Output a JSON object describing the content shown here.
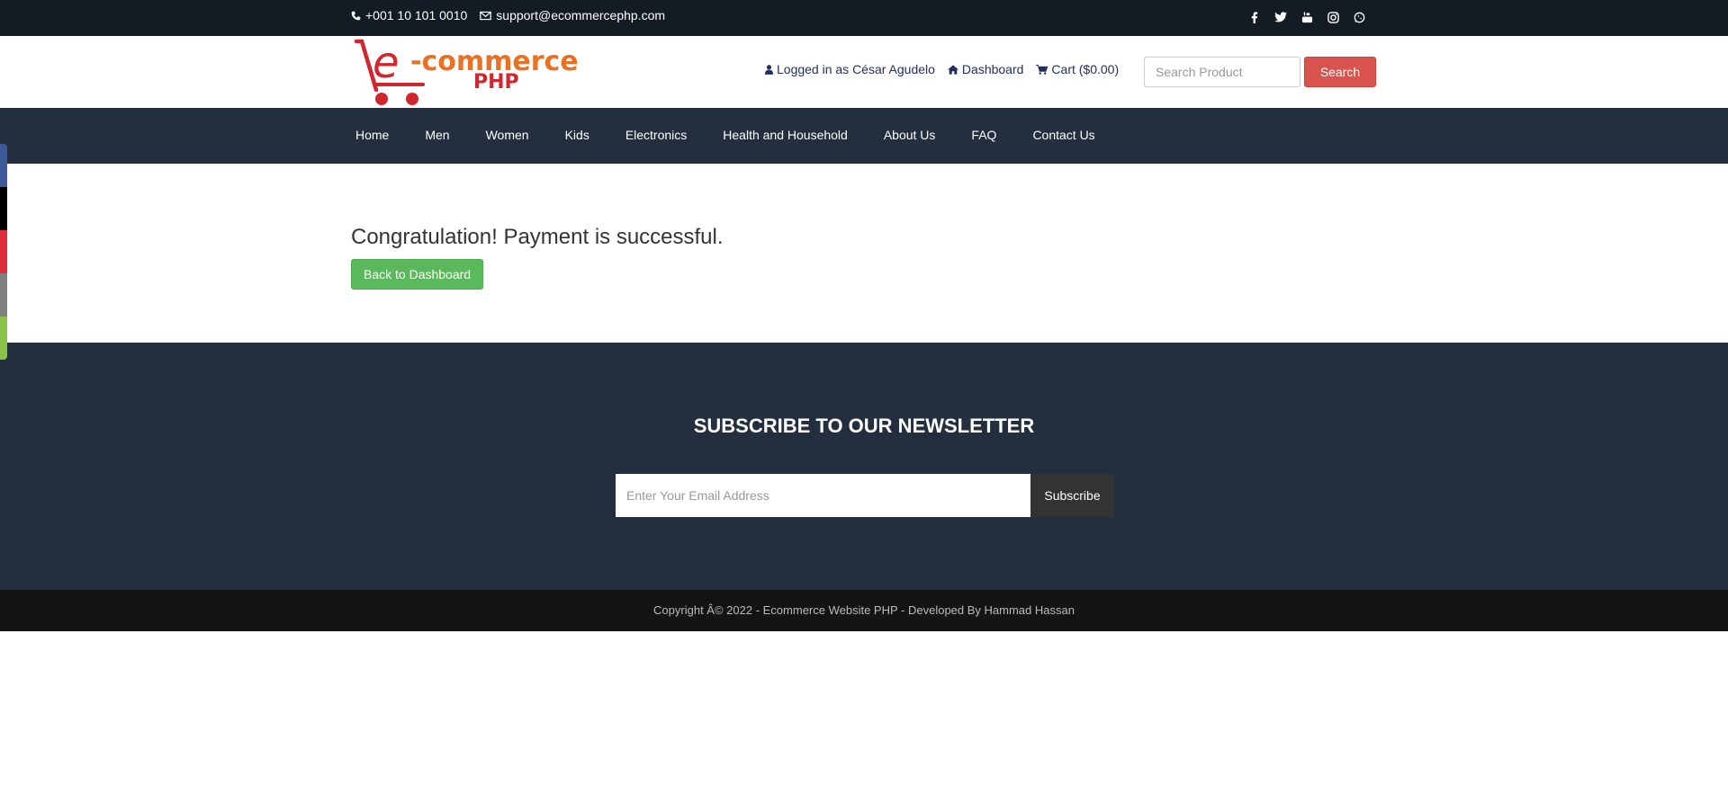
{
  "topbar": {
    "phone": "+001 10 101 0010",
    "email": "support@ecommercephp.com",
    "social_icons": [
      "facebook-icon",
      "twitter-icon",
      "youtube-icon",
      "instagram-icon",
      "whatsapp-icon"
    ]
  },
  "header": {
    "logo_text_main": "-commerce",
    "logo_text_sub": "PHP",
    "logged_in": "Logged in as César Agudelo",
    "dashboard": "Dashboard",
    "cart": "Cart ($0.00)",
    "search_placeholder": "Search Product",
    "search_button": "Search"
  },
  "nav": {
    "items": [
      "Home",
      "Men",
      "Women",
      "Kids",
      "Electronics",
      "Health and Household",
      "About Us",
      "FAQ",
      "Contact Us"
    ]
  },
  "side_strip_colors": [
    "#3b5998",
    "#000000",
    "#dd2e3a",
    "#7f7f7f",
    "#8bc34a"
  ],
  "main": {
    "message": "Congratulation! Payment is successful.",
    "back_button": "Back to Dashboard"
  },
  "newsletter": {
    "title": "SUBSCRIBE TO OUR NEWSLETTER",
    "email_placeholder": "Enter Your Email Address",
    "subscribe_button": "Subscribe"
  },
  "footer": {
    "copyright": "Copyright Â© 2022 - Ecommerce Website PHP - Developed By Hammad Hassan"
  },
  "colors": {
    "topbar": "#141b25",
    "nav": "#232e3f",
    "search_button": "#d9534f",
    "success_button": "#5cb85c",
    "footer": "#141414"
  }
}
